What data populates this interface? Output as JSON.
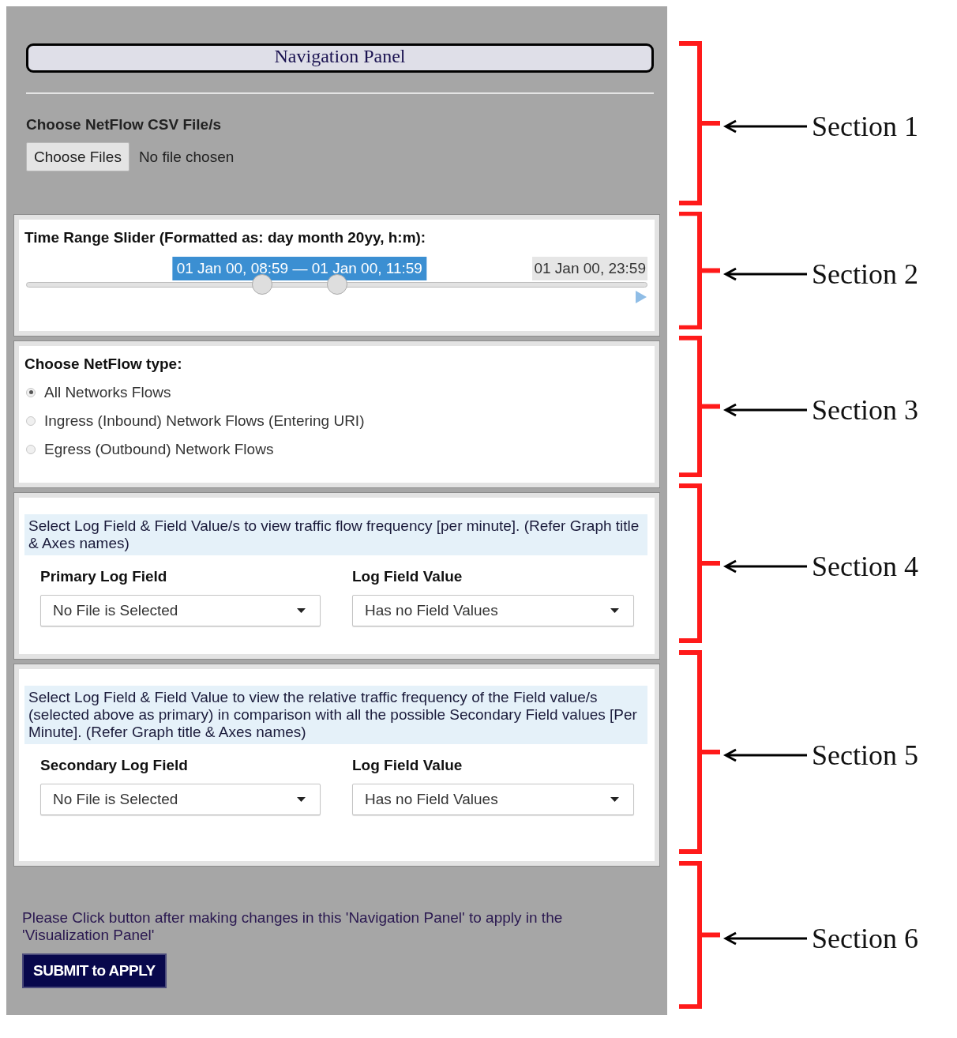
{
  "panel": {
    "title": "Navigation Panel",
    "file_section": {
      "label": "Choose NetFlow CSV File/s",
      "button": "Choose Files",
      "status": "No file chosen"
    },
    "time_range": {
      "label": "Time Range Slider (Formatted as: day month 20yy, h:m):",
      "range_reading": "01 Jan 00, 08:59 — 01 Jan 00, 11:59",
      "max_reading": "01 Jan 00, 23:59",
      "thumbs": [
        {
          "level": 0.38
        },
        {
          "level": 0.5
        }
      ]
    },
    "netflow_type": {
      "label": "Choose NetFlow type:",
      "options": [
        {
          "label": "All Networks Flows",
          "selected": true
        },
        {
          "label": "Ingress (Inbound) Network Flows (Entering URI)",
          "selected": false
        },
        {
          "label": "Egress (Outbound) Network Flows",
          "selected": false
        }
      ]
    },
    "primary": {
      "info": "Select Log Field & Field Value/s to view traffic flow frequency [per minute]. (Refer Graph title & Axes names)",
      "fields": [
        {
          "label": "Primary Log Field",
          "value": "No File is Selected"
        },
        {
          "label": "Log Field Value",
          "value": "Has no Field Values"
        }
      ]
    },
    "secondary": {
      "info": "Select Log Field & Field Value to view the relative traffic frequency of the Field value/s (selected above as primary) in comparison with all the possible Secondary Field values [Per Minute]. (Refer Graph title & Axes names)",
      "fields": [
        {
          "label": "Secondary Log Field",
          "value": "No File is Selected"
        },
        {
          "label": "Log Field Value",
          "value": "Has no Field Values"
        }
      ]
    },
    "submit": {
      "note": "Please Click button after making changes in this 'Navigation Panel' to apply in the 'Visualization Panel'",
      "button": "SUBMIT to APPLY"
    }
  },
  "annotations": [
    {
      "label": "Section 1"
    },
    {
      "label": "Section 2"
    },
    {
      "label": "Section 3"
    },
    {
      "label": "Section 4"
    },
    {
      "label": "Section 5"
    },
    {
      "label": "Section 6"
    }
  ]
}
